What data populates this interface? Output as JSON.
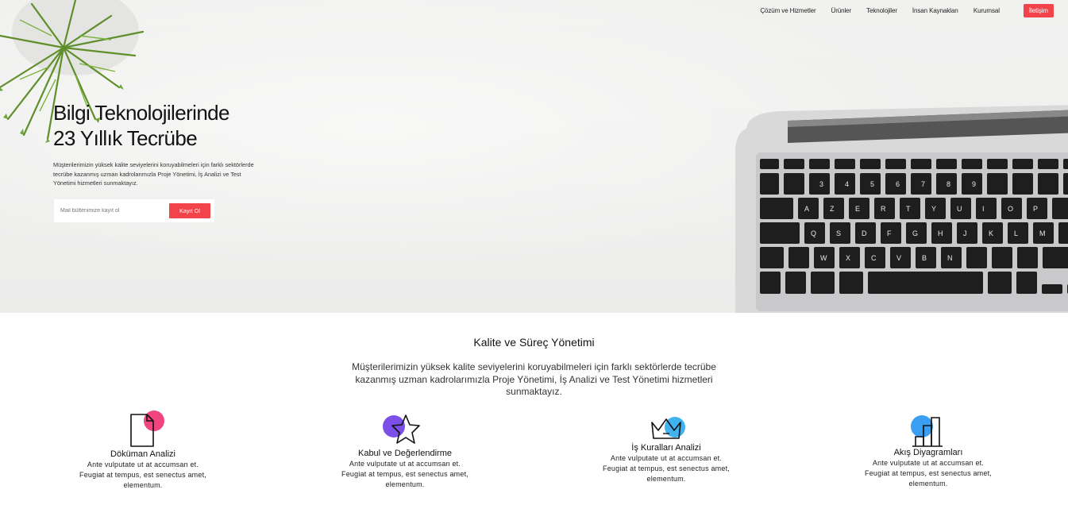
{
  "nav": {
    "items": [
      {
        "label": "Çözüm ve Hizmetler"
      },
      {
        "label": "Ürünler"
      },
      {
        "label": "Teknolojiler"
      },
      {
        "label": "İnsan Kaynakları"
      },
      {
        "label": "Kurumsal"
      }
    ],
    "cta_label": "İletişim"
  },
  "hero": {
    "title_line1": "Bilgi Teknolojilerinde",
    "title_line2": "23 Yıllık Tecrübe",
    "description": "Müşterilerimizin yüksek kalite seviyelerini koruyabilmeleri için farklı sektörlerde tecrübe kazanmış uzman kadrolarımızla Proje Yönetimi, İş Analizi ve Test Yönetimi hizmetleri sunmaktayız.",
    "newsletter_placeholder": "Mail bültenimize kayıt ol",
    "signup_label": "Kayıt Ol"
  },
  "section": {
    "title": "Kalite ve Süreç Yönetimi",
    "description": "Müşterilerimizin yüksek kalite seviyelerini koruyabilmeleri için farklı sektörlerde tecrübe kazanmış uzman kadrolarımızla Proje Yönetimi, İş Analizi ve Test Yönetimi hizmetleri sunmaktayız."
  },
  "features": [
    {
      "title": "Döküman Analizi",
      "text": "Ante vulputate ut at accumsan et. Feugiat at tempus, est senectus amet, elementum.",
      "icon": "document-icon",
      "accent": "#f0457f"
    },
    {
      "title": "Kabul ve Değerlendirme",
      "text": "Ante vulputate ut at accumsan et. Feugiat at tempus, est senectus amet, elementum.",
      "icon": "star-icon",
      "accent": "#7b4fe8"
    },
    {
      "title": "İş Kuralları Analizi",
      "text": "Ante vulputate ut at accumsan et. Feugiat at tempus, est senectus amet, elementum.",
      "icon": "crown-icon",
      "accent": "#3fb2ef"
    },
    {
      "title": "Akış Diyagramları",
      "text": "Ante vulputate ut at accumsan et. Feugiat at tempus, est senectus amet, elementum.",
      "icon": "bar-chart-icon",
      "accent": "#3a9ef2"
    }
  ],
  "colors": {
    "accent": "#f2424a"
  }
}
